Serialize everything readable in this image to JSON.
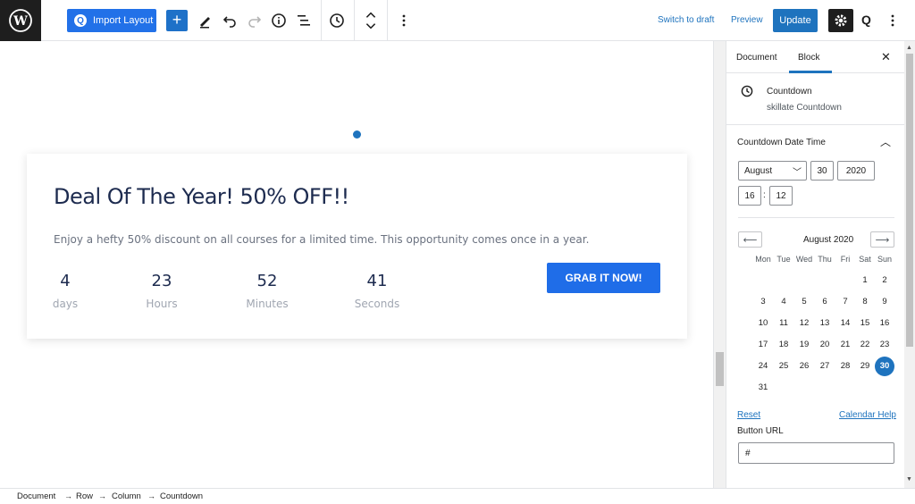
{
  "toolbar": {
    "import_label": "Import Layout",
    "switch_draft": "Switch to draft",
    "preview": "Preview",
    "update": "Update"
  },
  "block": {
    "title": "Deal Of The Year! 50% OFF!!",
    "description": "Enjoy a hefty 50% discount on all courses for a limited time. This opportunity comes once in a year.",
    "countdown": [
      {
        "value": "4",
        "unit": "days"
      },
      {
        "value": "23",
        "unit": "Hours"
      },
      {
        "value": "52",
        "unit": "Minutes"
      },
      {
        "value": "41",
        "unit": "Seconds"
      }
    ],
    "button_label": "GRAB IT NOW!"
  },
  "sidebar": {
    "tabs": [
      "Document",
      "Block"
    ],
    "active_tab": "Block",
    "block_name": "Countdown",
    "block_desc": "skillate Countdown",
    "panel_title": "Countdown Date Time",
    "month": "August",
    "day": "30",
    "year": "2020",
    "hour": "16",
    "minute": "12",
    "calendar": {
      "month_label": "August 2020",
      "weekdays": [
        "Mon",
        "Tue",
        "Wed",
        "Thu",
        "Fri",
        "Sat",
        "Sun"
      ],
      "first_weekday_index": 5,
      "days_in_month": 31,
      "selected_day": 30
    },
    "reset": "Reset",
    "calendar_help": "Calendar Help",
    "url_label": "Button URL",
    "url_value": "#"
  },
  "breadcrumb": [
    "Document",
    "Row",
    "Column",
    "Countdown"
  ],
  "colors": {
    "accent": "#1e73be",
    "button": "#1f6de8",
    "title": "#1d2b4f"
  }
}
